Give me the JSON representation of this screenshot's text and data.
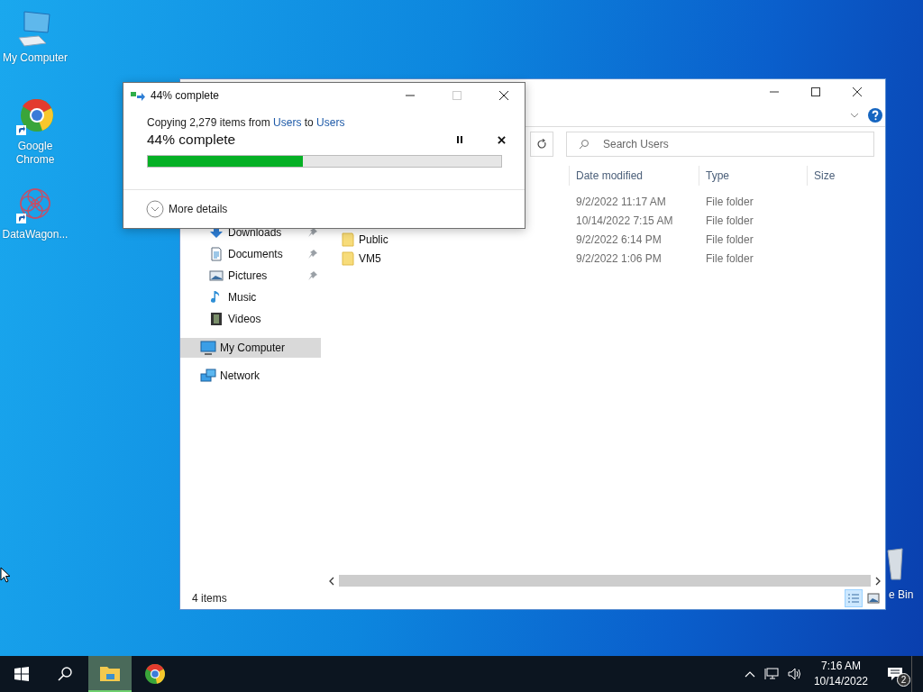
{
  "desktop": {
    "icons": [
      {
        "label": "My Computer",
        "kind": "computer",
        "shortcut": false
      },
      {
        "label": "Google Chrome",
        "kind": "chrome",
        "shortcut": true
      },
      {
        "label": "DataWagon...",
        "kind": "datawagon",
        "shortcut": true
      }
    ],
    "recycle_bin": {
      "label": "e Bin"
    }
  },
  "copy_dialog": {
    "title": "44% complete",
    "message": {
      "prefix": "Copying 2,279 items from",
      "source": "Users",
      "middle": "to",
      "destination": "Users"
    },
    "progress_text": "44% complete",
    "level": 0.44,
    "more_details": "More details"
  },
  "explorer": {
    "search": {
      "placeholder": "Search Users"
    },
    "nav": {
      "quick_access": [
        {
          "label": "Downloads",
          "kind": "downloads",
          "pinned": true
        },
        {
          "label": "Documents",
          "kind": "documents",
          "pinned": true
        },
        {
          "label": "Pictures",
          "kind": "pictures",
          "pinned": true
        },
        {
          "label": "Music",
          "kind": "music",
          "pinned": false
        },
        {
          "label": "Videos",
          "kind": "videos",
          "pinned": false
        }
      ],
      "items": [
        {
          "label": "My Computer",
          "kind": "computer",
          "selected": true
        },
        {
          "label": "Network",
          "kind": "network",
          "selected": false
        }
      ]
    },
    "columns": [
      "Date modified",
      "Type",
      "Size"
    ],
    "rows": [
      {
        "date_modified": "9/2/2022 11:17 AM",
        "type": "File folder"
      },
      {
        "date_modified": "10/14/2022 7:15 AM",
        "type": "File folder"
      },
      {
        "name": "Public",
        "date_modified": "9/2/2022 6:14 PM",
        "type": "File folder"
      },
      {
        "name": "VM5",
        "date_modified": "9/2/2022 1:06 PM",
        "type": "File folder"
      }
    ],
    "status": "4 items",
    "views": [
      {
        "kind": "details",
        "selected": true
      },
      {
        "kind": "thumbnails",
        "selected": false
      }
    ]
  },
  "taskbar": {
    "apps": [
      {
        "kind": "explorer",
        "active": true
      },
      {
        "kind": "chrome",
        "active": false
      }
    ],
    "time": "7:16 AM",
    "date": "10/14/2022",
    "notifications": "2"
  }
}
